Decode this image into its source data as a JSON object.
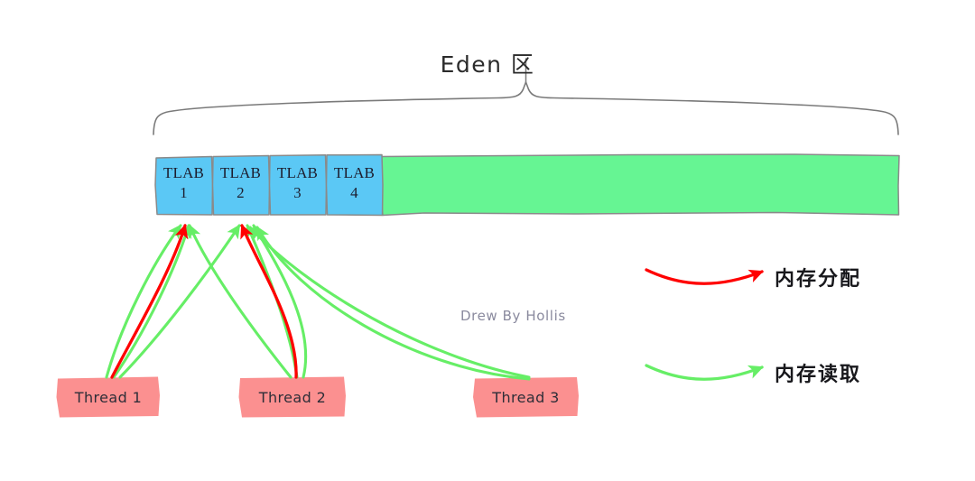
{
  "diagram": {
    "title": "Eden 区",
    "watermark": "Drew By Hollis",
    "colors": {
      "tlab_fill": "#5BC8F5",
      "free_fill": "#66F593",
      "block_stroke": "#8a8a8a",
      "thread_fill": "#FB9090",
      "allocation_arrow": "#FF0000",
      "read_arrow": "#66EE66",
      "brace_stroke": "#7a7a7a",
      "text": "#1d1d2e",
      "watermark_text": "#8a8a9e"
    },
    "eden": {
      "label": "Eden 区",
      "tlabs": [
        {
          "name": "TLAB",
          "index": "1"
        },
        {
          "name": "TLAB",
          "index": "2"
        },
        {
          "name": "TLAB",
          "index": "3"
        },
        {
          "name": "TLAB",
          "index": "4"
        }
      ],
      "free_region_label": ""
    },
    "threads": [
      {
        "label": "Thread 1"
      },
      {
        "label": "Thread 2"
      },
      {
        "label": "Thread 3"
      }
    ],
    "legend": [
      {
        "label": "内存分配",
        "color": "#FF0000",
        "kind": "allocation-arrow"
      },
      {
        "label": "内存读取",
        "color": "#66EE66",
        "kind": "read-arrow"
      }
    ]
  }
}
